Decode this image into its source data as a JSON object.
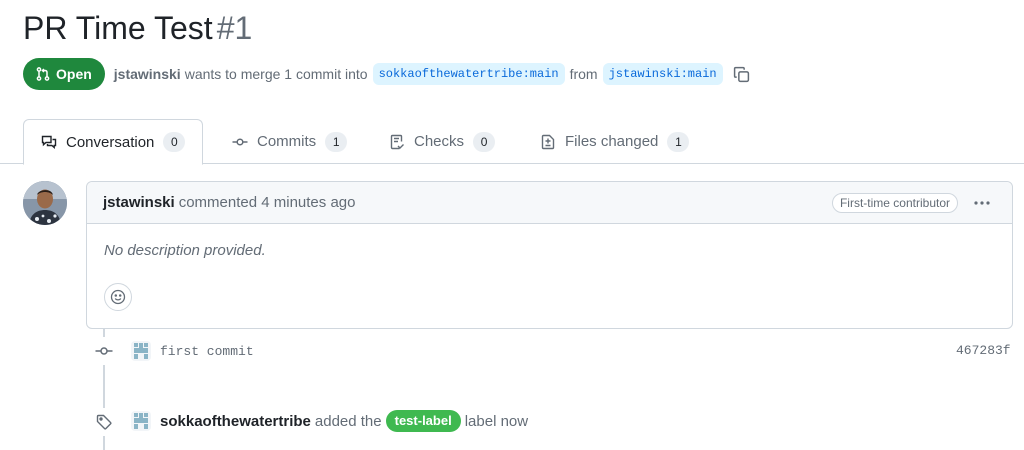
{
  "pr": {
    "title": "PR Time Test",
    "number": "#1",
    "state": "Open",
    "author": "jstawinski",
    "merge_text": "wants to merge 1 commit into",
    "base_branch": "sokkaofthewatertribe:main",
    "from_text": "from",
    "head_branch": "jstawinski:main"
  },
  "tabs": [
    {
      "label": "Conversation",
      "count": "0",
      "icon": "comment-discussion-icon"
    },
    {
      "label": "Commits",
      "count": "1",
      "icon": "git-commit-icon"
    },
    {
      "label": "Checks",
      "count": "0",
      "icon": "checklist-icon"
    },
    {
      "label": "Files changed",
      "count": "1",
      "icon": "file-diff-icon"
    }
  ],
  "comment": {
    "author": "jstawinski",
    "action": "commented 4 minutes ago",
    "badge": "First-time contributor",
    "body": "No description provided."
  },
  "timeline": {
    "commit_message": "first commit",
    "commit_sha": "467283f",
    "label_actor": "sokkaofthewatertribe",
    "label_action": "added the",
    "label_name": "test-label",
    "label_suffix": "label now"
  },
  "colors": {
    "open_state": "#1f883d",
    "branch_bg": "#ddf4ff",
    "branch_text": "#0969da",
    "label_bg": "#3fb950"
  }
}
